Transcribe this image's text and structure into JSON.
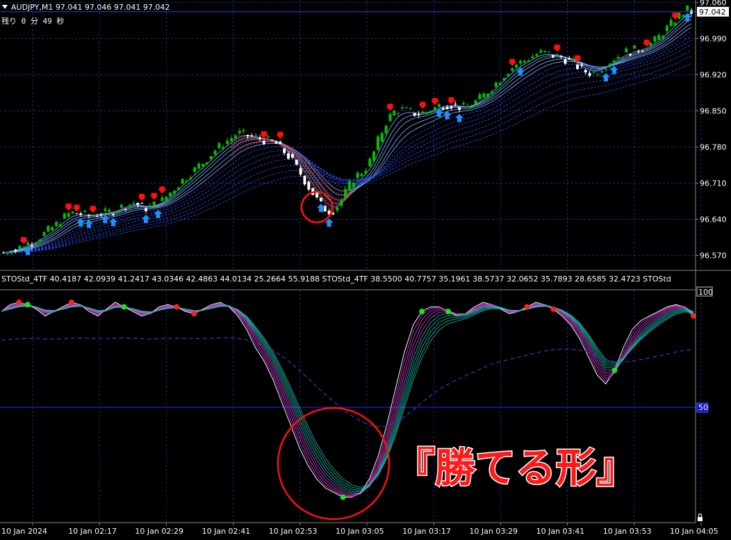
{
  "header": {
    "symbol_line": "AUDJPY,M1  97.041 97.046 97.041 97.042",
    "countdown": "残り 0 分 49 秒",
    "triangle_icon": "dropdown-triangle-icon"
  },
  "price_axis": {
    "ticks": [
      "97.060",
      "96.990",
      "96.920",
      "96.850",
      "96.780",
      "96.710",
      "96.640",
      "96.570"
    ],
    "current_price": "97.042",
    "range": [
      96.545,
      97.062
    ]
  },
  "indicator": {
    "header_text": "STOStd_4TF 40.4187 42.0939 41.2417 43.0346 42.4863 44.0134 25.2664 55.9188   STOStd_4TF 38.5500 40.7757 35.1961 38.5737 32.0652 35.7893 28.6585 32.4723   STOStd",
    "axis_top": "100",
    "axis_mid": "50",
    "axis_bottom_icon": "lock-icon"
  },
  "time_axis": {
    "ticks": [
      "10 Jan 2024",
      "10 Jan 02:17",
      "10 Jan 02:29",
      "10 Jan 02:41",
      "10 Jan 02:53",
      "10 Jan 03:05",
      "10 Jan 03:17",
      "10 Jan 03:29",
      "10 Jan 03:41",
      "10 Jan 03:53",
      "10 Jan 04:05"
    ]
  },
  "annotation": {
    "text": "『勝てる形』"
  },
  "colors": {
    "up_candle": "#00c000",
    "down_candle": "#ffffff",
    "grid": "#1c2a8c",
    "ribbon_up": "#7fb0ff",
    "ribbon_down": "#ff3030",
    "sell_arrow": "#ff1010",
    "buy_arrow": "#1e90ff",
    "annotation": "#ff1a1a",
    "stoch_magenta": "#e040e0",
    "stoch_teal": "#20c0b0"
  },
  "chart_data": [
    {
      "type": "candlestick",
      "title": "AUDJPY,M1",
      "ylim": [
        96.545,
        97.062
      ],
      "series_close_approx": [
        96.575,
        96.578,
        96.582,
        96.58,
        96.586,
        96.59,
        96.594,
        96.596,
        96.6,
        96.606,
        96.612,
        96.618,
        96.624,
        96.63,
        96.638,
        96.644,
        96.65,
        96.652,
        96.652,
        96.65,
        96.648,
        96.647,
        96.648,
        96.65,
        96.652,
        96.652,
        96.654,
        96.656,
        96.66,
        96.664,
        96.668,
        96.67,
        96.672,
        96.668,
        96.664,
        96.662,
        96.664,
        96.668,
        96.672,
        96.676,
        96.684,
        96.692,
        96.7,
        96.708,
        96.716,
        96.722,
        96.73,
        96.736,
        96.744,
        96.75,
        96.758,
        96.766,
        96.774,
        96.78,
        96.786,
        96.792,
        96.798,
        96.804,
        96.806,
        96.804,
        96.802,
        96.8,
        96.798,
        96.796,
        96.794,
        96.792,
        96.79,
        96.786,
        96.778,
        96.77,
        96.762,
        96.752,
        96.74,
        96.728,
        96.715,
        96.702,
        96.69,
        96.678,
        96.668,
        96.66,
        96.656,
        96.658,
        96.666,
        96.678,
        96.692,
        96.706,
        96.718,
        96.726,
        96.732,
        96.74,
        96.752,
        96.77,
        96.792,
        96.81,
        96.828,
        96.84,
        96.848,
        96.852,
        96.852,
        96.85,
        96.848,
        96.845,
        96.844,
        96.846,
        96.848,
        96.852,
        96.856,
        96.86,
        96.862,
        96.862,
        96.862,
        96.86,
        96.858,
        96.856,
        96.858,
        96.862,
        96.868,
        96.874,
        96.88,
        96.888,
        96.896,
        96.904,
        96.912,
        96.92,
        96.928,
        96.934,
        96.94,
        96.944,
        96.948,
        96.952,
        96.956,
        96.96,
        96.962,
        96.962,
        96.96,
        96.958,
        96.956,
        96.954,
        96.95,
        96.946,
        96.942,
        96.936,
        96.93,
        96.926,
        96.924,
        96.924,
        96.928,
        96.934,
        96.94,
        96.946,
        96.952,
        96.956,
        96.96,
        96.964,
        96.966,
        96.968,
        96.97,
        96.972,
        96.976,
        96.98,
        96.986,
        96.994,
        97.002,
        97.01,
        97.018,
        97.026,
        97.034,
        97.04,
        97.046,
        97.042
      ]
    },
    {
      "type": "line",
      "title": "STOStd_4TF",
      "ylim": [
        0,
        100
      ],
      "series": [
        {
          "values": [
            92,
            95,
            96,
            95,
            93,
            90,
            92,
            94,
            96,
            95,
            92,
            90,
            93,
            96,
            94,
            92,
            90,
            91,
            94,
            95,
            94,
            92,
            91,
            93,
            95,
            96,
            94,
            90,
            84,
            76,
            70,
            62,
            52,
            42,
            32,
            24,
            18,
            14,
            12,
            10,
            10,
            12,
            18,
            28,
            42,
            58,
            74,
            86,
            92,
            94,
            94,
            92,
            90,
            91,
            94,
            96,
            95,
            93,
            91,
            92,
            94,
            96,
            95,
            93,
            90,
            86,
            80,
            72,
            64,
            60,
            66,
            76,
            84,
            88,
            90,
            92,
            94,
            95,
            94,
            90
          ]
        }
      ]
    }
  ]
}
